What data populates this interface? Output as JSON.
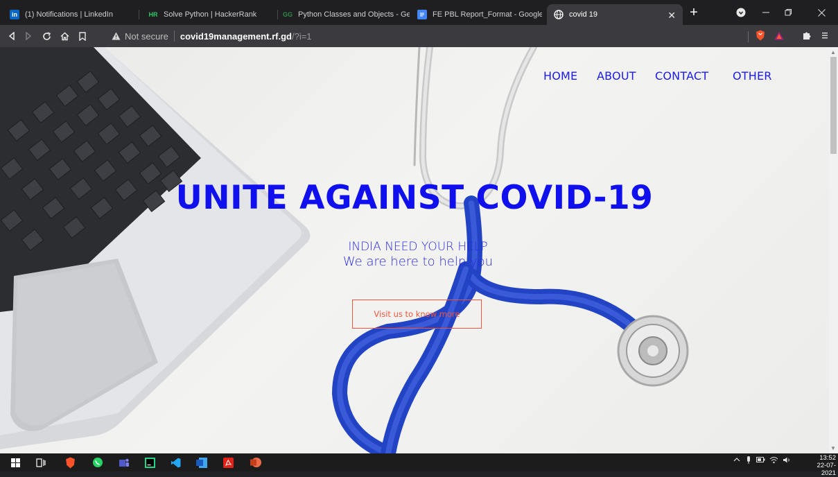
{
  "browser": {
    "tabs": [
      {
        "label": "(1) Notifications | LinkedIn",
        "icon": "linkedin-icon",
        "icon_color": "#0a66c2"
      },
      {
        "label": "Solve Python | HackerRank",
        "icon": "hackerrank-icon",
        "icon_color": "#2ec866"
      },
      {
        "label": "Python Classes and Objects - GeeksforGe",
        "icon": "geeksforgeeks-icon",
        "icon_color": "#2f8d46"
      },
      {
        "label": "FE PBL Report_Format - Google Docs",
        "icon": "google-docs-icon",
        "icon_color": "#4285f4"
      },
      {
        "label": "covid 19",
        "icon": "globe-icon",
        "active": true
      }
    ],
    "new_tab_symbol": "+",
    "address": {
      "security_label": "Not secure",
      "host": "covid19management.rf.gd",
      "path": "/?i=1"
    },
    "extensions": [
      "brave-shield-icon",
      "brave-rewards-icon",
      "extensions-puzzle-icon",
      "menu-icon"
    ]
  },
  "site": {
    "nav": [
      "HOME",
      "ABOUT",
      "CONTACT",
      "OTHER"
    ],
    "hero": {
      "title": "UNITE AGAINST COVID-19",
      "subtitle_line1": "INDIA NEED YOUR HELP",
      "subtitle_line2": "We are here to help you",
      "cta_label": "Visit us to know more"
    },
    "colors": {
      "link": "#1b1be6",
      "title": "#1010ee",
      "cta": "#f0543a",
      "stethoscope": "#2244c4"
    }
  },
  "taskbar": {
    "apps": [
      "windows-start-icon",
      "task-view-icon",
      "brave-icon",
      "whatsapp-icon",
      "teams-icon",
      "pycharm-icon",
      "vscode-icon",
      "word-icon",
      "acrobat-icon",
      "powerpoint-icon"
    ],
    "time": "13:52",
    "date": "22-07-2021"
  }
}
